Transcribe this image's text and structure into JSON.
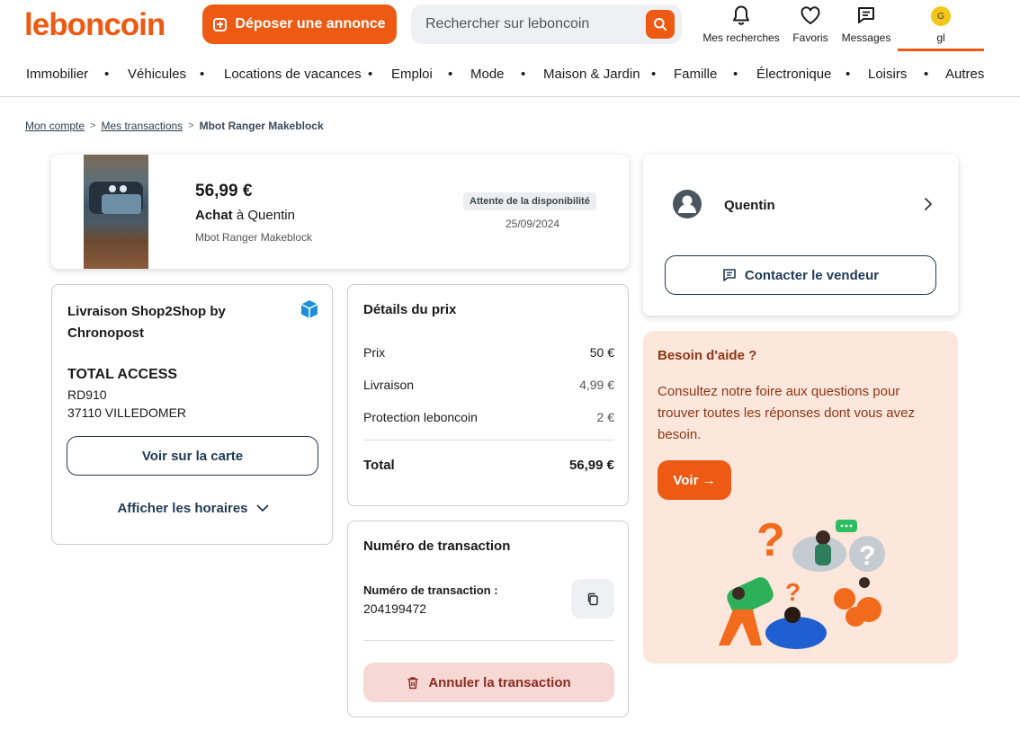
{
  "header": {
    "logo": "leboncoin",
    "deposit_label": "Déposer une annonce",
    "search_placeholder": "Rechercher sur leboncoin",
    "actions": [
      {
        "label": "Mes recherches",
        "icon": "bell-icon"
      },
      {
        "label": "Favoris",
        "icon": "heart-icon"
      },
      {
        "label": "Messages",
        "icon": "message-icon"
      },
      {
        "label": "gl",
        "icon": "avatar",
        "avatar_letter": "G"
      }
    ]
  },
  "categories": [
    "Immobilier",
    "Véhicules",
    "Locations de vacances",
    "Emploi",
    "Mode",
    "Maison & Jardin",
    "Famille",
    "Électronique",
    "Loisirs",
    "Autres"
  ],
  "category_separator": "•",
  "breadcrumb": {
    "items": [
      "Mon compte",
      "Mes transactions"
    ],
    "current": "Mbot Ranger Makeblock",
    "separator": ">"
  },
  "product": {
    "price": "56,99 €",
    "action": "Achat",
    "seller_phrase": "à Quentin",
    "title": "Mbot Ranger Makeblock",
    "status": "Attente de la disponibilité",
    "date": "25/09/2024"
  },
  "seller": {
    "name": "Quentin",
    "contact_label": "Contacter le vendeur"
  },
  "delivery": {
    "title": "Livraison Shop2Shop by Chronopost",
    "pickup_name": "TOTAL ACCESS",
    "address_line1": "RD910",
    "address_line2": "37110 VILLEDOMER",
    "map_label": "Voir sur la carte",
    "hours_label": "Afficher les horaires"
  },
  "price_details": {
    "title": "Détails du prix",
    "rows": [
      {
        "label": "Prix",
        "value": "50 €"
      },
      {
        "label": "Livraison",
        "value": "4,99 €"
      },
      {
        "label": "Protection leboncoin",
        "value": "2 €"
      }
    ],
    "total_label": "Total",
    "total_value": "56,99 €"
  },
  "transaction": {
    "title": "Numéro de transaction",
    "label": "Numéro de transaction :",
    "number": "204199472",
    "cancel_label": "Annuler la transaction"
  },
  "help": {
    "title": "Besoin d'aide ?",
    "body": "Consultez notre foire aux questions pour trouver toutes les réponses dont vous avez besoin.",
    "button_label": "Voir →"
  },
  "colors": {
    "brand": "#ec5a13",
    "navy": "#1f3a55",
    "help_bg": "#fde6dc",
    "help_text": "#8c3714",
    "cancel_bg": "#f6d9d5",
    "cancel_text": "#8e2a21",
    "chronopost_blue": "#1e8fd6"
  }
}
